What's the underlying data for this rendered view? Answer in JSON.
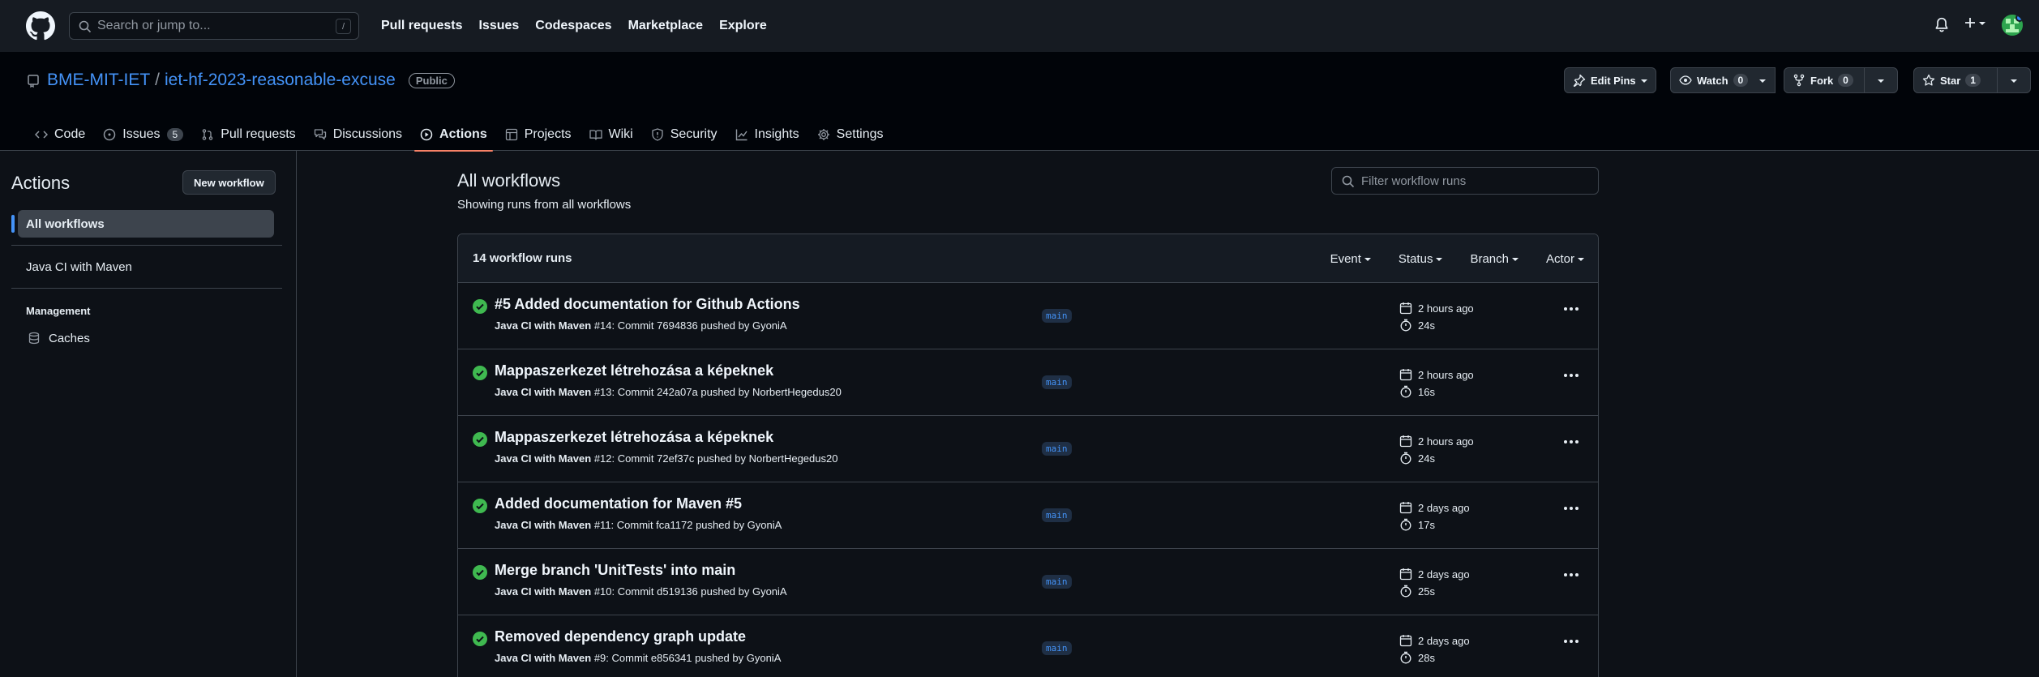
{
  "header": {
    "search_placeholder": "Search or jump to...",
    "search_shortcut": "/",
    "nav": [
      "Pull requests",
      "Issues",
      "Codespaces",
      "Marketplace",
      "Explore"
    ]
  },
  "repo": {
    "owner": "BME-MIT-IET",
    "separator": "/",
    "name": "iet-hf-2023-reasonable-excuse",
    "visibility": "Public",
    "edit_pins": "Edit Pins",
    "watch_label": "Watch",
    "watch_count": "0",
    "fork_label": "Fork",
    "fork_count": "0",
    "star_label": "Star",
    "star_count": "1"
  },
  "tabs": [
    {
      "label": "Code",
      "icon": "code-icon"
    },
    {
      "label": "Issues",
      "icon": "issue-icon",
      "count": "5"
    },
    {
      "label": "Pull requests",
      "icon": "pull-request-icon"
    },
    {
      "label": "Discussions",
      "icon": "discussion-icon"
    },
    {
      "label": "Actions",
      "icon": "play-icon",
      "active": true
    },
    {
      "label": "Projects",
      "icon": "table-icon"
    },
    {
      "label": "Wiki",
      "icon": "book-icon"
    },
    {
      "label": "Security",
      "icon": "shield-icon"
    },
    {
      "label": "Insights",
      "icon": "graph-icon"
    },
    {
      "label": "Settings",
      "icon": "gear-icon"
    }
  ],
  "sidebar": {
    "title": "Actions",
    "new_workflow": "New workflow",
    "all_workflows": "All workflows",
    "workflow": "Java CI with Maven",
    "management": "Management",
    "caches": "Caches"
  },
  "main": {
    "title": "All workflows",
    "subtitle": "Showing runs from all workflows",
    "filter_placeholder": "Filter workflow runs",
    "count": "14 workflow runs",
    "filters": [
      "Event",
      "Status",
      "Branch",
      "Actor"
    ]
  },
  "runs": [
    {
      "title": "#5 Added documentation for Github Actions",
      "workflow": "Java CI with Maven",
      "meta": " #14: Commit 7694836 pushed by GyoniA",
      "branch": "main",
      "time": "2 hours ago",
      "duration": "24s"
    },
    {
      "title": "Mappaszerkezet létrehozása a képeknek",
      "workflow": "Java CI with Maven",
      "meta": " #13: Commit 242a07a pushed by NorbertHegedus20",
      "branch": "main",
      "time": "2 hours ago",
      "duration": "16s"
    },
    {
      "title": "Mappaszerkezet létrehozása a képeknek",
      "workflow": "Java CI with Maven",
      "meta": " #12: Commit 72ef37c pushed by NorbertHegedus20",
      "branch": "main",
      "time": "2 hours ago",
      "duration": "24s"
    },
    {
      "title": "Added documentation for Maven #5",
      "workflow": "Java CI with Maven",
      "meta": " #11: Commit fca1172 pushed by GyoniA",
      "branch": "main",
      "time": "2 days ago",
      "duration": "17s"
    },
    {
      "title": "Merge branch 'UnitTests' into main",
      "workflow": "Java CI with Maven",
      "meta": " #10: Commit d519136 pushed by GyoniA",
      "branch": "main",
      "time": "2 days ago",
      "duration": "25s"
    },
    {
      "title": "Removed dependency graph update",
      "workflow": "Java CI with Maven",
      "meta": " #9: Commit e856341 pushed by GyoniA",
      "branch": "main",
      "time": "2 days ago",
      "duration": "28s"
    }
  ]
}
